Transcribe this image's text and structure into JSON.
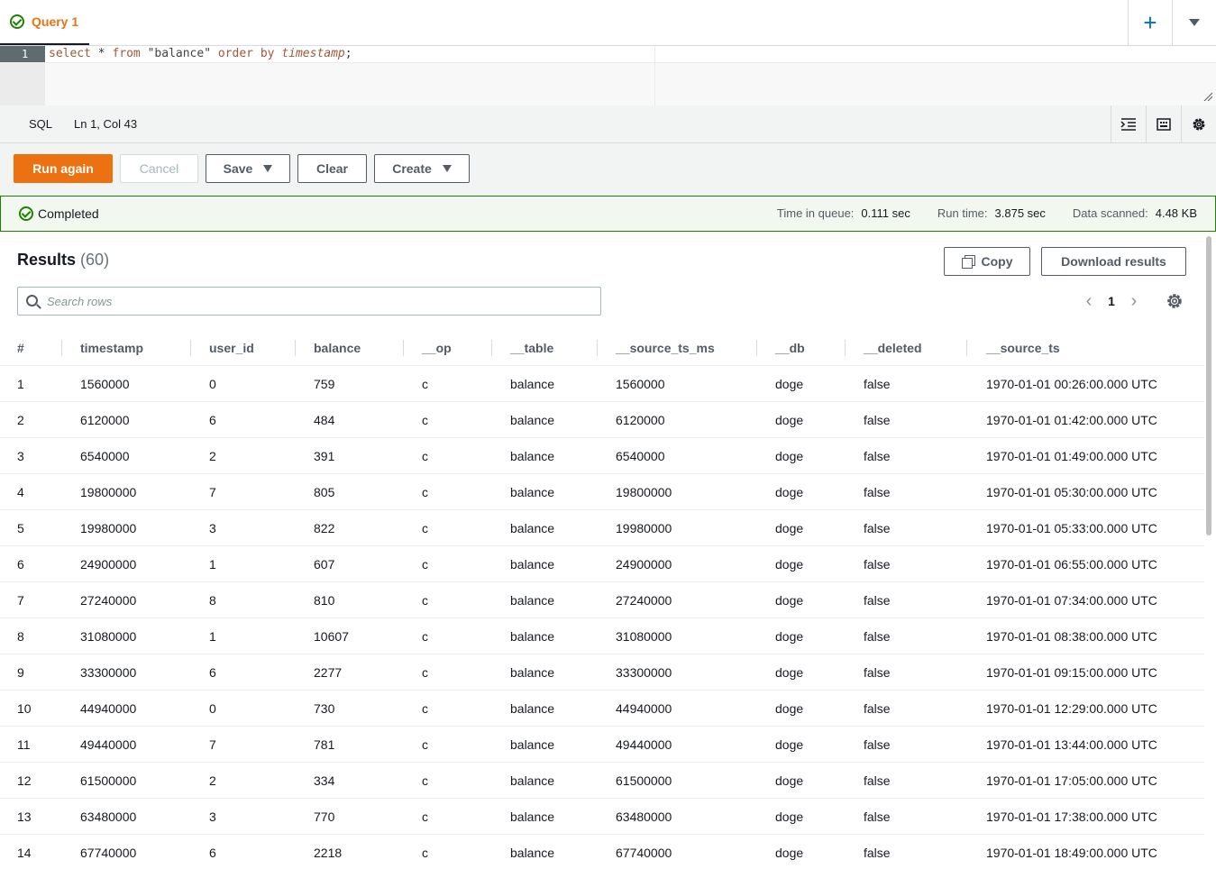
{
  "tabs": {
    "active_label": "Query 1"
  },
  "editor": {
    "line_number": "1",
    "code": {
      "kw1": "select",
      "star": " * ",
      "kw2": "from",
      "table_literal": " \"balance\" ",
      "kw3": "order by",
      "space": " ",
      "ident": "timestamp",
      "end": ";"
    }
  },
  "statusbar": {
    "language": "SQL",
    "cursor": "Ln 1, Col 43"
  },
  "buttons": {
    "run": "Run again",
    "cancel": "Cancel",
    "save": "Save",
    "clear": "Clear",
    "create": "Create"
  },
  "banner": {
    "status": "Completed",
    "queue_label": "Time in queue:",
    "queue_value": "0.111 sec",
    "run_label": "Run time:",
    "run_value": "3.875 sec",
    "scanned_label": "Data scanned:",
    "scanned_value": "4.48 KB",
    "color": "#1d8102"
  },
  "results": {
    "title": "Results",
    "count": "(60)",
    "copy": "Copy",
    "download": "Download results",
    "search_placeholder": "Search rows",
    "page": "1",
    "columns": [
      "#",
      "timestamp",
      "user_id",
      "balance",
      "__op",
      "__table",
      "__source_ts_ms",
      "__db",
      "__deleted",
      "__source_ts"
    ],
    "rows": [
      [
        "1",
        "1560000",
        "0",
        "759",
        "c",
        "balance",
        "1560000",
        "doge",
        "false",
        "1970-01-01 00:26:00.000 UTC"
      ],
      [
        "2",
        "6120000",
        "6",
        "484",
        "c",
        "balance",
        "6120000",
        "doge",
        "false",
        "1970-01-01 01:42:00.000 UTC"
      ],
      [
        "3",
        "6540000",
        "2",
        "391",
        "c",
        "balance",
        "6540000",
        "doge",
        "false",
        "1970-01-01 01:49:00.000 UTC"
      ],
      [
        "4",
        "19800000",
        "7",
        "805",
        "c",
        "balance",
        "19800000",
        "doge",
        "false",
        "1970-01-01 05:30:00.000 UTC"
      ],
      [
        "5",
        "19980000",
        "3",
        "822",
        "c",
        "balance",
        "19980000",
        "doge",
        "false",
        "1970-01-01 05:33:00.000 UTC"
      ],
      [
        "6",
        "24900000",
        "1",
        "607",
        "c",
        "balance",
        "24900000",
        "doge",
        "false",
        "1970-01-01 06:55:00.000 UTC"
      ],
      [
        "7",
        "27240000",
        "8",
        "810",
        "c",
        "balance",
        "27240000",
        "doge",
        "false",
        "1970-01-01 07:34:00.000 UTC"
      ],
      [
        "8",
        "31080000",
        "1",
        "10607",
        "c",
        "balance",
        "31080000",
        "doge",
        "false",
        "1970-01-01 08:38:00.000 UTC"
      ],
      [
        "9",
        "33300000",
        "6",
        "2277",
        "c",
        "balance",
        "33300000",
        "doge",
        "false",
        "1970-01-01 09:15:00.000 UTC"
      ],
      [
        "10",
        "44940000",
        "0",
        "730",
        "c",
        "balance",
        "44940000",
        "doge",
        "false",
        "1970-01-01 12:29:00.000 UTC"
      ],
      [
        "11",
        "49440000",
        "7",
        "781",
        "c",
        "balance",
        "49440000",
        "doge",
        "false",
        "1970-01-01 13:44:00.000 UTC"
      ],
      [
        "12",
        "61500000",
        "2",
        "334",
        "c",
        "balance",
        "61500000",
        "doge",
        "false",
        "1970-01-01 17:05:00.000 UTC"
      ],
      [
        "13",
        "63480000",
        "3",
        "770",
        "c",
        "balance",
        "63480000",
        "doge",
        "false",
        "1970-01-01 17:38:00.000 UTC"
      ],
      [
        "14",
        "67740000",
        "6",
        "2218",
        "c",
        "balance",
        "67740000",
        "doge",
        "false",
        "1970-01-01 18:49:00.000 UTC"
      ]
    ]
  },
  "colors": {
    "accent": "#ec7211",
    "link": "#0073bb",
    "success": "#1d8102"
  },
  "icons": [
    "check-circle-icon",
    "plus-icon",
    "chevron-down-icon",
    "indent-icon",
    "keyboard-icon",
    "gear-icon",
    "search-icon",
    "copy-icon",
    "chevron-left-icon",
    "chevron-right-icon",
    "sort-icon",
    "resize-icon"
  ]
}
